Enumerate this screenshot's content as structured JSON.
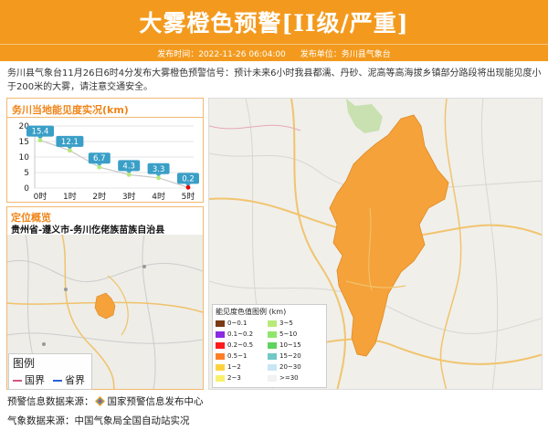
{
  "header": {
    "title": "大雾橙色预警[II级/严重]",
    "publish_time_label": "发布时间：2022-11-26 06:04:00",
    "publisher_label": "发布单位：务川县气象台",
    "bg_color": "#f39a1e"
  },
  "description": "务川县气象台11月26日6时4分发布大雾橙色预警信号：预计未来6小时我县都濡、丹砂、泥高等高海拔乡镇部分路段将出现能见度小于200米的大雾，请注意交通安全。",
  "visibility_panel": {
    "title": "务川当地能见度实况(km)"
  },
  "chart_data": {
    "type": "line",
    "categories": [
      "0时",
      "1时",
      "2时",
      "3时",
      "4时",
      "5时"
    ],
    "values": [
      15.4,
      12.1,
      6.7,
      4.3,
      3.3,
      0.2
    ],
    "point_colors": [
      "#b4e878",
      "#b4e878",
      "#b4e878",
      "#b4e878",
      "#b4e878",
      "#e60000"
    ],
    "label_color": "#3a9fc7",
    "ylim": [
      0,
      20
    ],
    "yticks": [
      0,
      5,
      10,
      15,
      20
    ],
    "grid": true
  },
  "location": {
    "title": "定位概览",
    "region": "贵州省-遵义市-务川仡佬族苗族自治县"
  },
  "map_legend": {
    "title": "图例",
    "items": [
      {
        "label": "国界",
        "color": "#d4577b",
        "icon": "border-line-icon"
      },
      {
        "label": "省界",
        "color": "#2a63d6",
        "icon": "border-line-icon"
      }
    ]
  },
  "visibility_legend": {
    "title": "能见度色值图例 (km)",
    "items": [
      {
        "label": "0~0.1",
        "color": "#7a3b16"
      },
      {
        "label": "3~5",
        "color": "#b8ea7a"
      },
      {
        "label": "0.1~0.2",
        "color": "#8a2be2"
      },
      {
        "label": "5~10",
        "color": "#8ee66c"
      },
      {
        "label": "0.2~0.5",
        "color": "#ff1c1c"
      },
      {
        "label": "10~15",
        "color": "#5fd35f"
      },
      {
        "label": "0.5~1",
        "color": "#ff7f27"
      },
      {
        "label": "15~20",
        "color": "#72c7c7"
      },
      {
        "label": "1~2",
        "color": "#ffd23c"
      },
      {
        "label": "20~30",
        "color": "#c9e6f5"
      },
      {
        "label": "2~3",
        "color": "#f7f16c"
      },
      {
        "label": ">=30",
        "color": "#f2f2f2"
      }
    ]
  },
  "warning_area_color": "#f5a23a",
  "footer": {
    "warning_source_label": "预警信息数据来源：",
    "warning_source_logo": "diamond-logo-icon",
    "warning_source": "国家预警信息发布中心",
    "weather_source": "气象数据来源：中国气象局全国自动站实况"
  }
}
